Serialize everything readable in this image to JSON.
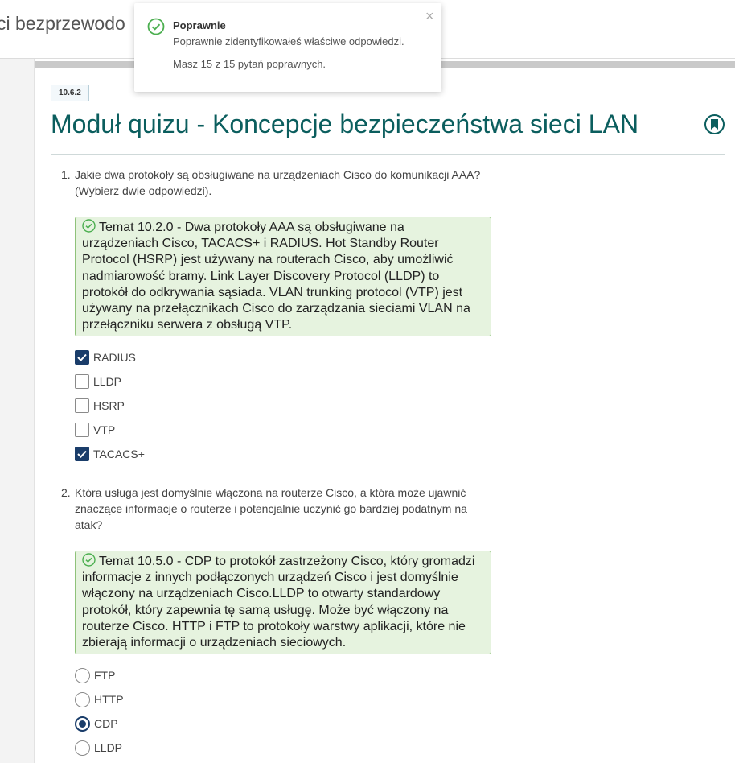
{
  "header": {
    "title_fragment": "ci bezprzewodo"
  },
  "module": {
    "badge": "10.6.2",
    "title": "Moduł quizu - Koncepcje bezpieczeństwa sieci LAN"
  },
  "toast": {
    "title": "Poprawnie",
    "message": "Poprawnie zidentyfikowałeś właściwe odpowiedzi.",
    "score": "Masz 15 z 15 pytań poprawnych."
  },
  "questions": [
    {
      "number": "1.",
      "text": "Jakie dwa protokoły są obsługiwane na urządzeniach Cisco do komunikacji AAA? (Wybierz dwie odpowiedzi).",
      "feedback": "Temat 10.2.0 - Dwa protokoły AAA są obsługiwane na urządzeniach Cisco, TACACS+ i RADIUS. Hot Standby Router Protocol (HSRP) jest używany na routerach Cisco, aby umożliwić nadmiarowość bramy. Link Layer Discovery Protocol (LLDP) to protokół do odkrywania sąsiada. VLAN trunking protocol (VTP) jest używany na przełącznikach Cisco do zarządzania sieciami VLAN na przełączniku serwera z obsługą VTP.",
      "options": [
        {
          "label": "RADIUS",
          "checked": true
        },
        {
          "label": "LLDP",
          "checked": false
        },
        {
          "label": "HSRP",
          "checked": false
        },
        {
          "label": "VTP",
          "checked": false
        },
        {
          "label": "TACACS+",
          "checked": true
        }
      ]
    },
    {
      "number": "2.",
      "text": "Która usługa jest domyślnie włączona na routerze Cisco, a która może ujawnić znaczące informacje o routerze i potencjalnie uczynić go bardziej podatnym na atak?",
      "feedback": "Temat 10.5.0 - CDP to protokół zastrzeżony Cisco, który gromadzi informacje z innych podłączonych urządzeń Cisco i jest domyślnie włączony na urządzeniach Cisco.LLDP to otwarty standardowy protokół, który zapewnia tę samą usługę. Może być włączony na routerze Cisco. HTTP i FTP to protokoły warstwy aplikacji, które nie zbierają informacji o urządzeniach sieciowych.",
      "options": [
        {
          "label": "FTP",
          "checked": false
        },
        {
          "label": "HTTP",
          "checked": false
        },
        {
          "label": "CDP",
          "checked": true
        },
        {
          "label": "LLDP",
          "checked": false
        }
      ]
    }
  ],
  "colors": {
    "accent": "#0b5e5e",
    "checked": "#1a3d6a",
    "feedback_bg": "#e6f3df",
    "feedback_border": "#8fc27a",
    "success": "#4caf50"
  }
}
